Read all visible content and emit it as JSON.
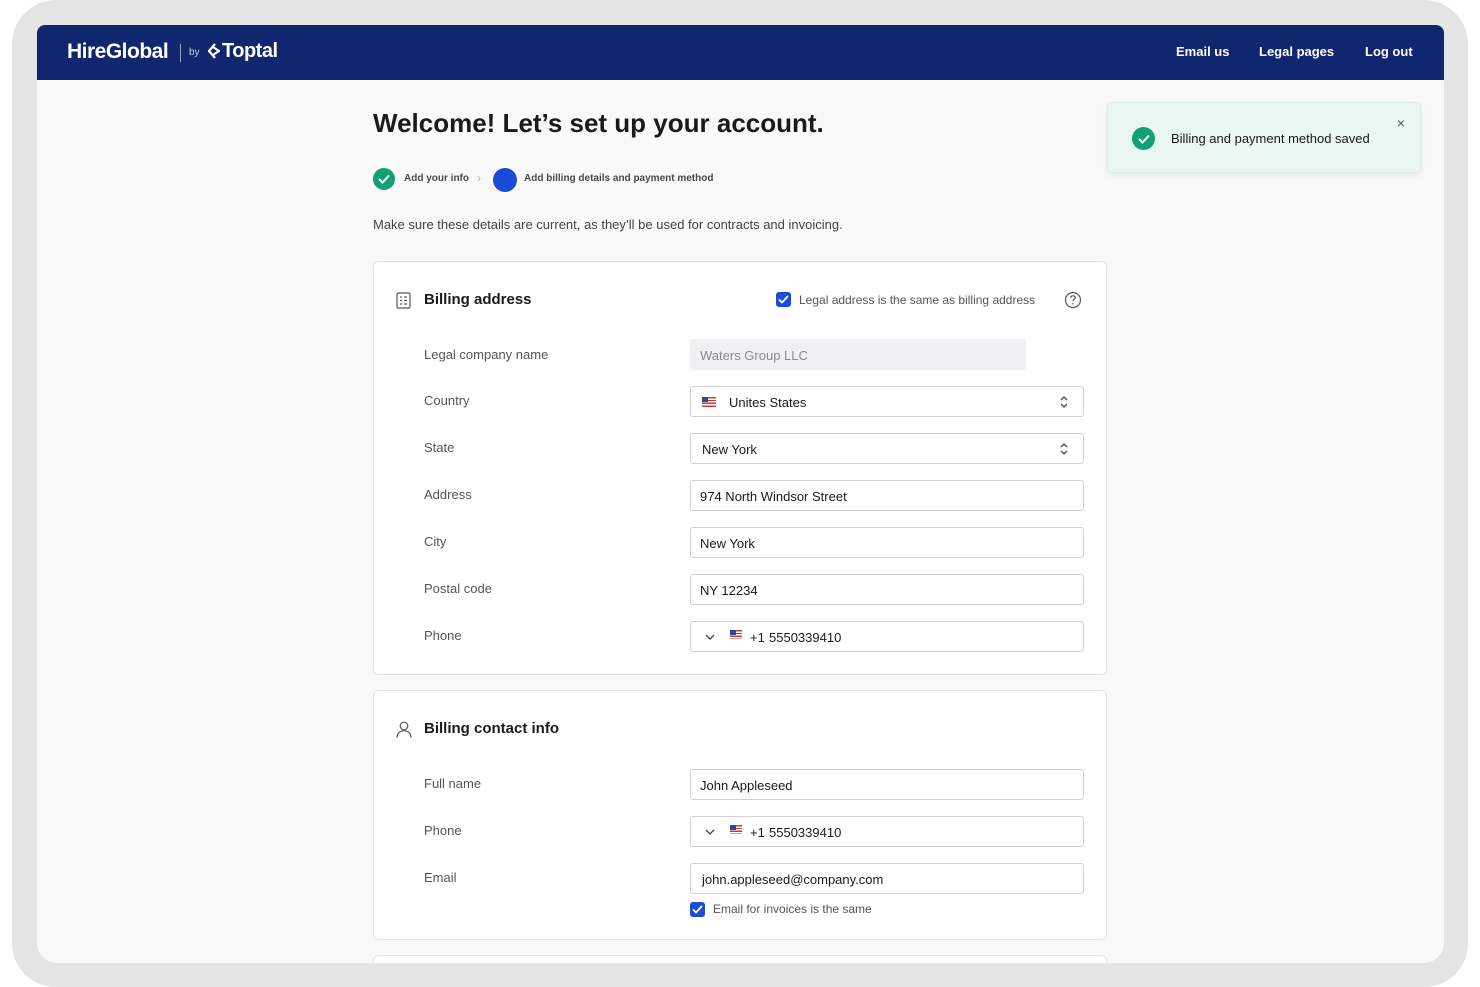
{
  "header": {
    "brand": "HireGlobal",
    "by": "by",
    "partner": "Toptal",
    "nav": [
      {
        "label": "Email us"
      },
      {
        "label": "Legal pages"
      },
      {
        "label": "Log out"
      }
    ]
  },
  "page": {
    "title": "Welcome! Let’s set up your account.",
    "steps": [
      {
        "label": "Add your info",
        "status": "done"
      },
      {
        "label": "Add billing details and payment method",
        "status": "current"
      }
    ],
    "intro": "Make sure these details are current, as they’ll be used for contracts and invoicing."
  },
  "billing_address": {
    "title": "Billing address",
    "same_as_legal_label": "Legal address is the same as billing address",
    "same_as_legal_checked": true,
    "fields": {
      "company": {
        "label": "Legal company name",
        "value": "Waters Group LLC"
      },
      "country": {
        "label": "Country",
        "value": "Unites States"
      },
      "state": {
        "label": "State",
        "value": "New York"
      },
      "address": {
        "label": "Address",
        "value": "974 North Windsor Street"
      },
      "city": {
        "label": "City",
        "value": "New York"
      },
      "postal": {
        "label": "Postal code",
        "value": "NY 12234"
      },
      "phone": {
        "label": "Phone",
        "code": "+1",
        "value": "5550339410"
      }
    }
  },
  "billing_contact": {
    "title": "Billing contact info",
    "fields": {
      "full_name": {
        "label": "Full name",
        "value": "John Appleseed"
      },
      "phone": {
        "label": "Phone",
        "code": "+1",
        "value": "5550339410"
      },
      "email": {
        "label": "Email",
        "value": "john.appleseed@company.com"
      }
    },
    "invoice_email_same_label": "Email for invoices is the same",
    "invoice_email_same_checked": true
  },
  "toast": {
    "message": "Billing and payment method saved",
    "close_glyph": "×"
  },
  "colors": {
    "header_bg": "#102770",
    "accent_blue": "#1d4ad6",
    "success_green": "#14a076",
    "toast_bg": "#eaf6f1"
  }
}
